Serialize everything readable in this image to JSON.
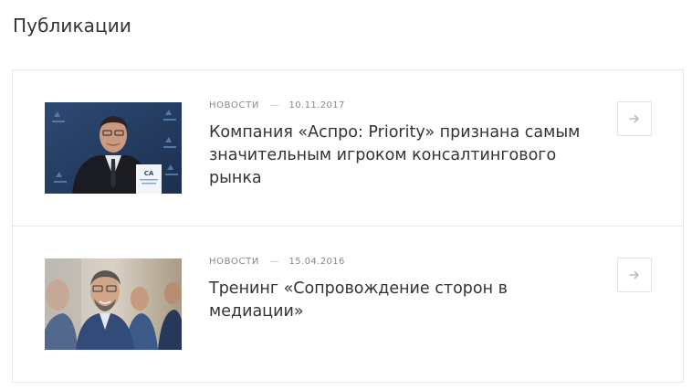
{
  "section": {
    "title": "Публикации"
  },
  "items": [
    {
      "category": "Новости",
      "separator": "—",
      "date": "10.11.2017",
      "title": "Компания «Аспро: Priority» признана самым значительным игроком консалтингового рынка",
      "image_icon": "award-photo-icon"
    },
    {
      "category": "Новости",
      "separator": "—",
      "date": "15.04.2016",
      "title": "Тренинг «Сопровождение сторон в медиации»",
      "image_icon": "meeting-photo-icon"
    }
  ],
  "colors": {
    "text": "#333333",
    "meta": "#888888",
    "border": "#e8e8e8",
    "arrow": "#c4c4c4"
  }
}
